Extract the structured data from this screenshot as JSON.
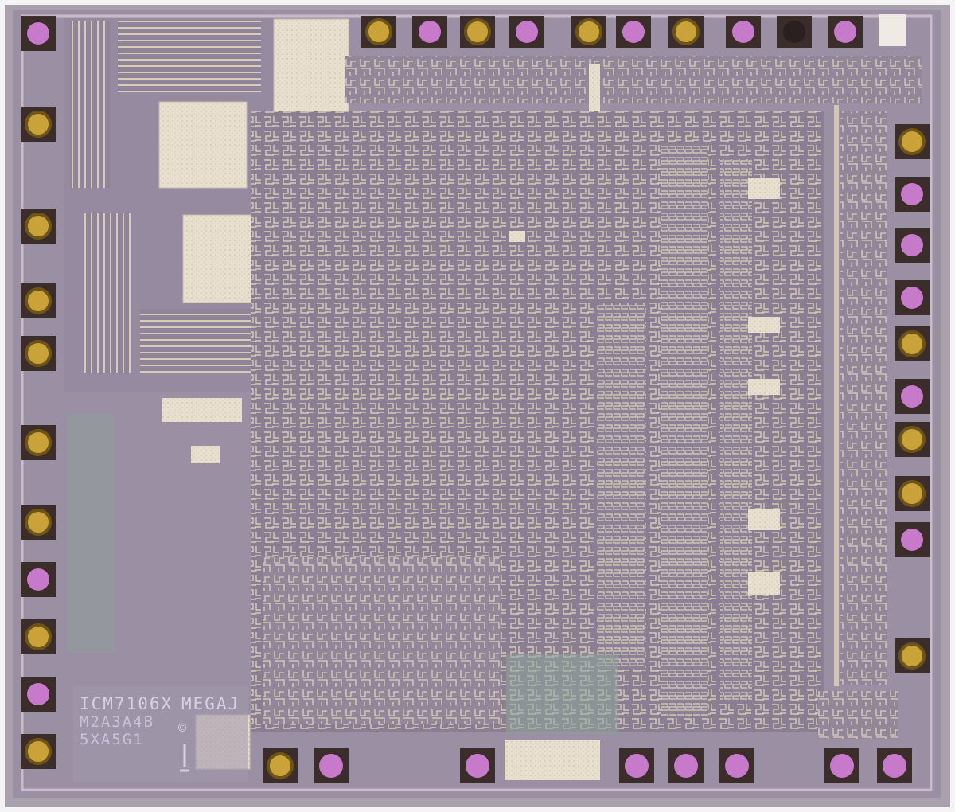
{
  "image": {
    "subject": "integrated circuit die photograph",
    "colors": {
      "background": "#f4f4f4",
      "substrate": "#9a8fa3",
      "substrate_dark": "#84788e",
      "metal": "#e6dccb",
      "metal_edge": "#c8bba8",
      "wire": "#d8ccb8",
      "pad_frame": "#3a2d2a",
      "pad_gold": "#c9a23a",
      "pad_gold_dark": "#6e5418",
      "pad_pink": "#c77ac9",
      "green_region": "#8ea49a"
    }
  },
  "die_markings": {
    "part_number": "ICM7106X",
    "maker": "MEGAJ",
    "code_line_1": "M2A3A4B",
    "code_line_2": "5XA5G1",
    "copyright": "©"
  },
  "bond_pads": {
    "top": [
      "gold",
      "pink",
      "gold",
      "pink",
      "gold",
      "pink",
      "gold",
      "pink",
      "pink",
      "pink",
      "white"
    ],
    "left": [
      "pink",
      "gold",
      "gold",
      "gold",
      "gold",
      "gold",
      "gold",
      "pink",
      "gold",
      "pink",
      "gold"
    ],
    "right": [
      "gold",
      "pink",
      "pink",
      "pink",
      "gold",
      "pink",
      "gold",
      "gold",
      "pink",
      "gold"
    ],
    "bottom": [
      "gold",
      "pink",
      "pink",
      "pink",
      "pink",
      "pink",
      "pink",
      "pink"
    ]
  }
}
